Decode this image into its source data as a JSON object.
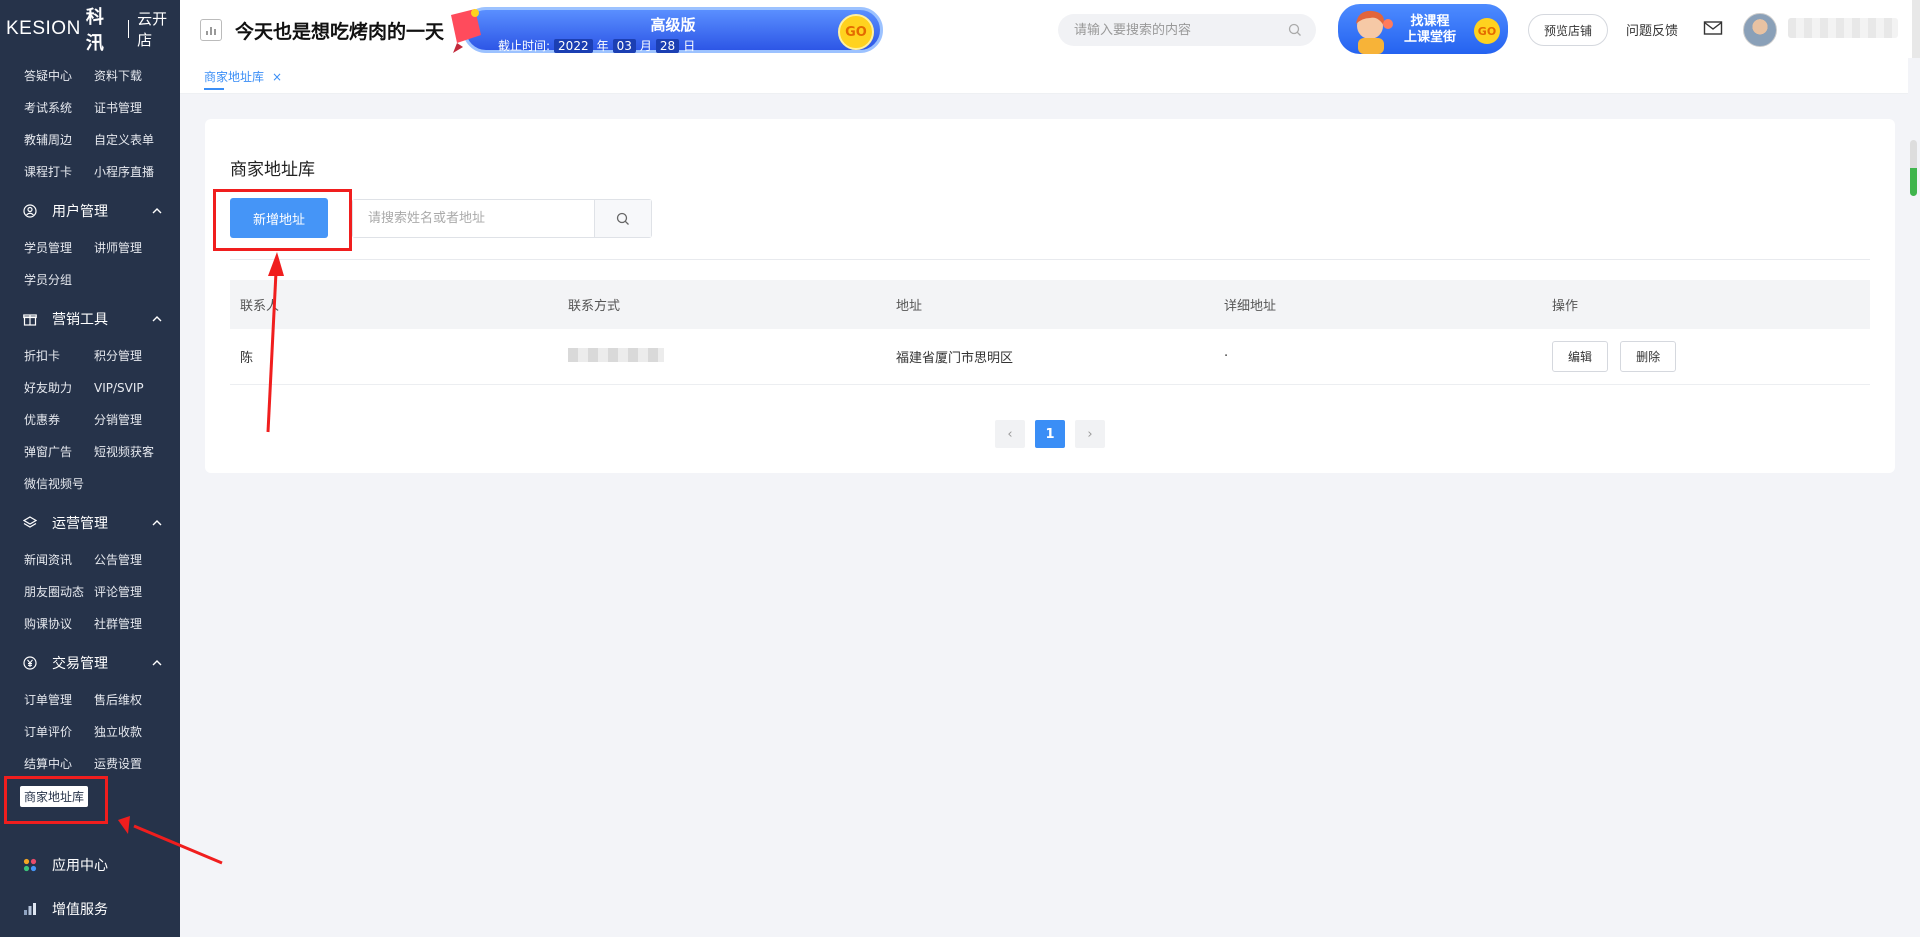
{
  "logo": {
    "brand": "KESION",
    "brand_cn": "科汛",
    "store": "云开店"
  },
  "sidebar": {
    "grid1": [
      "答疑中心",
      "资料下载",
      "考试系统",
      "证书管理",
      "教辅周边",
      "自定义表单",
      "课程打卡",
      "小程序直播"
    ],
    "sections": {
      "user": {
        "label": "用户管理",
        "items": [
          "学员管理",
          "讲师管理",
          "学员分组"
        ]
      },
      "marketing": {
        "label": "营销工具",
        "items": [
          "折扣卡",
          "积分管理",
          "好友助力",
          "VIP/SVIP",
          "优惠券",
          "分销管理",
          "弹窗广告",
          "短视频获客",
          "微信视频号"
        ]
      },
      "ops": {
        "label": "运营管理",
        "items": [
          "新闻资讯",
          "公告管理",
          "朋友圈动态",
          "评论管理",
          "购课协议",
          "社群管理"
        ]
      },
      "trade": {
        "label": "交易管理",
        "items": [
          "订单管理",
          "售后维权",
          "订单评价",
          "独立收款",
          "结算中心",
          "运费设置"
        ]
      }
    },
    "active_item": "商家地址库",
    "app_center": "应用中心",
    "value_added": "增值服务"
  },
  "header": {
    "title": "今天也是想吃烤肉的一天",
    "promo": {
      "level": "高级版",
      "deadline_label": "截止时间:",
      "year": "2022",
      "year_unit": "年",
      "month": "03",
      "month_unit": "月",
      "day": "28",
      "day_unit": "日",
      "go": "GO"
    },
    "search_placeholder": "请输入要搜索的内容",
    "course_banner": {
      "line1": "找课程",
      "line2": "上课堂街",
      "go": "GO"
    },
    "preview_store": "预览店铺",
    "feedback": "问题反馈"
  },
  "tabs": [
    {
      "label": "商家地址库",
      "close": "×"
    }
  ],
  "page": {
    "title": "商家地址库",
    "add_button": "新增地址",
    "search_placeholder": "请搜索姓名或者地址",
    "table": {
      "headers": [
        "联系人",
        "联系方式",
        "地址",
        "详细地址",
        "操作"
      ],
      "rows": [
        {
          "contact": "陈",
          "address": "福建省厦门市思明区",
          "detail": "·",
          "edit": "编辑",
          "delete": "删除"
        }
      ]
    },
    "pagination": {
      "prev": "‹",
      "current": "1",
      "next": "›"
    }
  },
  "colors": {
    "sidebar_bg": "#26334a",
    "primary": "#4595f7",
    "highlight_red": "#f01e1e"
  }
}
